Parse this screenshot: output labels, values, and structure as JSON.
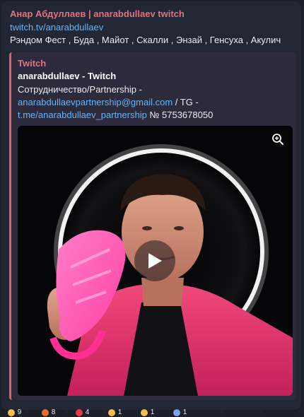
{
  "message": {
    "sender": "Анар Абдуллаев | anarabdullaev twitch",
    "link": "twitch.tv/anarabdullaev",
    "text": "Рэндом Фест , Буда , Майот , Скалли , Энзай , Генсуха , Акулич"
  },
  "preview": {
    "site_name": "Twitch",
    "title": "anarabdullaev - Twitch",
    "desc_prefix": "Сотрудничество/Partnership -",
    "email": "anarabdullaevpartnership@gmail.com",
    "tg_label": " / TG -",
    "tg_link": "t.me/anarabdullaev_partnership",
    "number": " № 5753678050"
  },
  "media": {
    "zoom_icon": "zoom-in-icon",
    "play_icon": "play-icon"
  },
  "reactions": [
    {
      "icon": "thumbs-up-icon",
      "color": "#f2c04a",
      "count": "9"
    },
    {
      "icon": "fire-icon",
      "color": "#f06b2e",
      "count": "8"
    },
    {
      "icon": "heart-icon",
      "color": "#e23b45",
      "count": "4"
    },
    {
      "icon": "party-icon",
      "color": "#f2c04a",
      "count": "1"
    },
    {
      "icon": "smile-icon",
      "color": "#f2c04a",
      "count": "1"
    },
    {
      "icon": "emoji-icon",
      "color": "#7aa5e8",
      "count": "1"
    }
  ]
}
